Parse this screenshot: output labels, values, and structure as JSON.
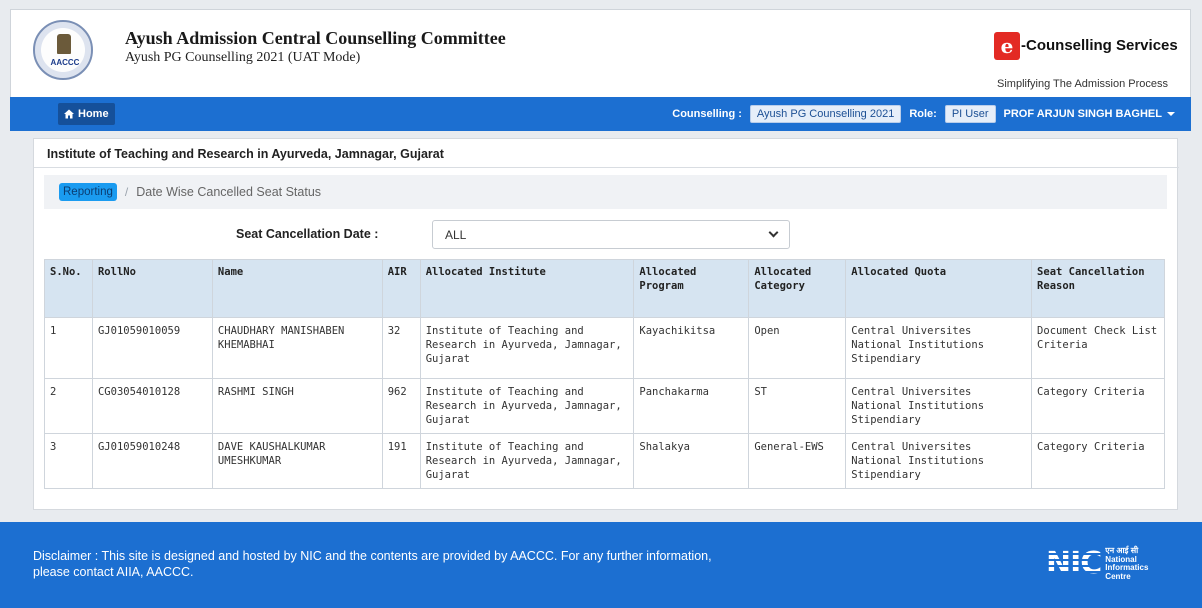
{
  "header": {
    "seal_text": "AACCC",
    "title": "Ayush Admission Central Counselling Committee",
    "subtitle": "Ayush PG Counselling 2021 (UAT Mode)",
    "brand_icon_letter": "e",
    "brand_name": "-Counselling Services",
    "brand_tagline": "Simplifying The Admission Process"
  },
  "navbar": {
    "home_label": "Home",
    "counselling_label": "Counselling :",
    "counselling_value": "Ayush PG Counselling 2021",
    "role_label": "Role:",
    "role_value": "PI User",
    "user_name": "PROF ARJUN SINGH BAGHEL"
  },
  "main": {
    "institute_title": "Institute of Teaching and Research in Ayurveda, Jamnagar, Gujarat",
    "breadcrumb": {
      "active": "Reporting",
      "separator": "/",
      "current": "Date Wise Cancelled Seat Status"
    },
    "filter": {
      "label": "Seat Cancellation Date :",
      "selected": "ALL"
    },
    "table": {
      "headers": [
        "S.No.",
        "RollNo",
        "Name",
        "AIR",
        "Allocated Institute",
        "Allocated Program",
        "Allocated Category",
        "Allocated Quota",
        "Seat Cancellation Reason"
      ],
      "rows": [
        [
          "1",
          "GJ01059010059",
          "CHAUDHARY MANISHABEN KHEMABHAI",
          "32",
          "Institute of Teaching and Research in Ayurveda, Jamnagar, Gujarat",
          "Kayachikitsa",
          "Open",
          "Central Universites National Institutions Stipendiary",
          "Document Check List Criteria"
        ],
        [
          "2",
          "CG03054010128",
          "RASHMI SINGH",
          "962",
          "Institute of Teaching and Research in Ayurveda, Jamnagar, Gujarat",
          "Panchakarma",
          "ST",
          "Central Universites National Institutions Stipendiary",
          "Category Criteria"
        ],
        [
          "3",
          "GJ01059010248",
          "DAVE KAUSHALKUMAR UMESHKUMAR",
          "191",
          "Institute of Teaching and Research in Ayurveda, Jamnagar, Gujarat",
          "Shalakya",
          "General-EWS",
          "Central Universites National Institutions Stipendiary",
          "Category Criteria"
        ]
      ]
    }
  },
  "footer": {
    "disclaimer": "Disclaimer : This site is designed and hosted by NIC and the contents are provided by AACCC. For any further information, please contact AIIA, AACCC.",
    "nic_mark": "NIC",
    "nic_text": [
      "एन आई सी",
      "National",
      "Informatics",
      "Centre"
    ]
  },
  "colors": {
    "primary_blue": "#1c6fd1",
    "table_header_bg": "#d6e4f1",
    "breadcrumb_active": "#1a9bf0",
    "brand_red": "#e32a24"
  }
}
